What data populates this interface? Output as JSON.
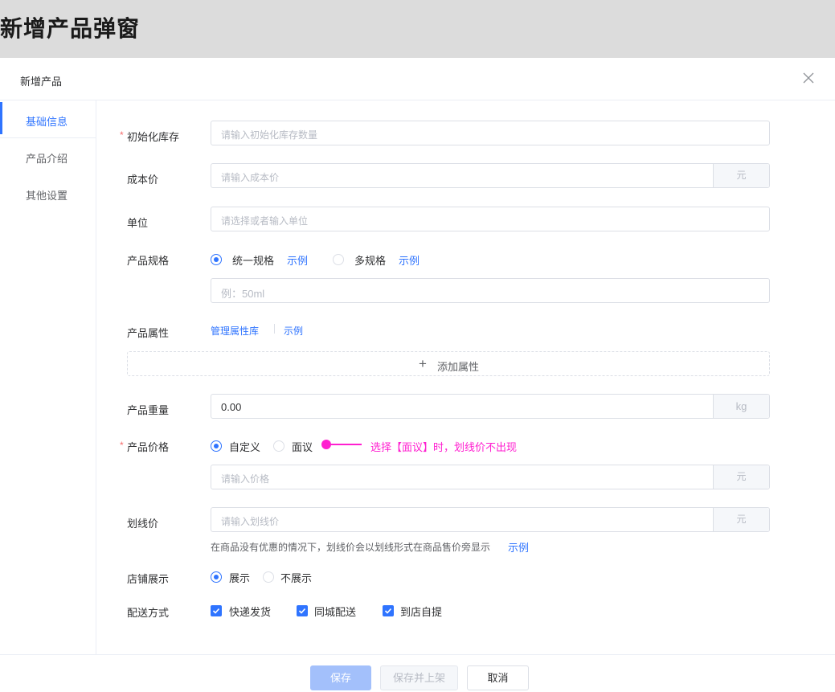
{
  "page": {
    "title": "新增产品弹窗"
  },
  "dialog": {
    "title": "新增产品"
  },
  "side_nav": {
    "items": [
      {
        "label": "基础信息",
        "active": true
      },
      {
        "label": "产品介绍",
        "active": false
      },
      {
        "label": "其他设置",
        "active": false
      }
    ]
  },
  "form": {
    "initial_stock": {
      "label": "初始化库存",
      "placeholder": "请输入初始化库存数量",
      "required": true
    },
    "cost_price": {
      "label": "成本价",
      "placeholder": "请输入成本价",
      "unit": "元"
    },
    "unit": {
      "label": "单位",
      "placeholder": "请选择或者输入单位"
    },
    "spec": {
      "label": "产品规格",
      "options": [
        {
          "label": "统一规格",
          "checked": true
        },
        {
          "label": "多规格",
          "checked": false
        }
      ],
      "example_link": "示例",
      "input_placeholder": "例：50ml"
    },
    "attributes": {
      "label": "产品属性",
      "manage_link": "管理属性库",
      "example_link": "示例",
      "add_button": "添加属性"
    },
    "weight": {
      "label": "产品重量",
      "value": "0.00",
      "unit": "kg"
    },
    "price": {
      "label": "产品价格",
      "required": true,
      "options": [
        {
          "label": "自定义",
          "checked": true
        },
        {
          "label": "面议",
          "checked": false
        }
      ],
      "annotation": "选择【面议】时，划线价不出现",
      "placeholder": "请输入价格",
      "unit": "元"
    },
    "strike_price": {
      "label": "划线价",
      "placeholder": "请输入划线价",
      "unit": "元",
      "hint": "在商品没有优惠的情况下，划线价会以划线形式在商品售价旁显示",
      "hint_link": "示例"
    },
    "store_display": {
      "label": "店铺展示",
      "options": [
        {
          "label": "展示",
          "checked": true
        },
        {
          "label": "不展示",
          "checked": false
        }
      ]
    },
    "delivery": {
      "label": "配送方式",
      "options": [
        {
          "label": "快递发货",
          "checked": true
        },
        {
          "label": "同城配送",
          "checked": true
        },
        {
          "label": "到店自提",
          "checked": true
        }
      ]
    }
  },
  "footer": {
    "save_label": "保存",
    "save_publish_label": "保存并上架",
    "cancel_label": "取消"
  },
  "colors": {
    "accent": "#2f74ff",
    "annotation": "#ff1fd0",
    "required": "#f56c6c"
  }
}
